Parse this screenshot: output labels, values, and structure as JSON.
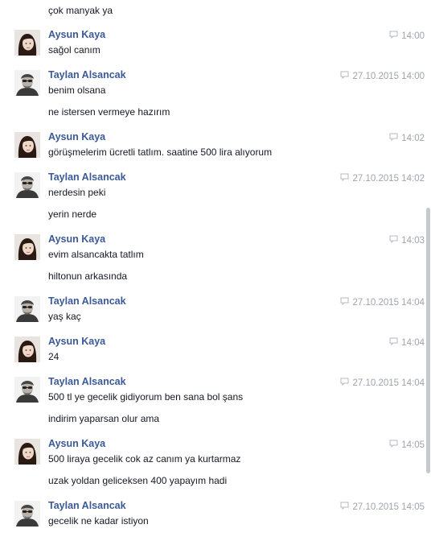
{
  "conversation": {
    "top_continuation": "çok manyak ya",
    "groups": [
      {
        "sender": "Aysun Kaya",
        "avatar": "woman-avatar",
        "time": "14:00",
        "lines": [
          "sağol canım"
        ]
      },
      {
        "sender": "Taylan Alsancak",
        "avatar": "man-avatar",
        "time": "27.10.2015 14:00",
        "lines": [
          "benim olsana",
          "ne istersen vermeye hazırım"
        ]
      },
      {
        "sender": "Aysun Kaya",
        "avatar": "woman-avatar",
        "time": "14:02",
        "lines": [
          "görüşmelerim ücretli tatlım. saatine 500 lira alıyorum"
        ]
      },
      {
        "sender": "Taylan Alsancak",
        "avatar": "man-avatar",
        "time": "27.10.2015 14:02",
        "lines": [
          "nerdesin peki",
          "yerin nerde"
        ]
      },
      {
        "sender": "Aysun Kaya",
        "avatar": "woman-avatar",
        "time": "14:03",
        "lines": [
          "evim alsancakta tatlım",
          "hiltonun arkasında"
        ]
      },
      {
        "sender": "Taylan Alsancak",
        "avatar": "man-avatar",
        "time": "27.10.2015 14:04",
        "lines": [
          "yaş kaç"
        ]
      },
      {
        "sender": "Aysun Kaya",
        "avatar": "woman-avatar",
        "time": "14:04",
        "lines": [
          "24"
        ]
      },
      {
        "sender": "Taylan Alsancak",
        "avatar": "man-avatar",
        "time": "27.10.2015 14:04",
        "lines": [
          "500 tl ye gecelik gidiyorum ben sana bol şans",
          "indirim yaparsan olur ama"
        ]
      },
      {
        "sender": "Aysun Kaya",
        "avatar": "woman-avatar",
        "time": "14:05",
        "lines": [
          "500 liraya gecelik cok az canım ya kurtarmaz",
          "uzak yoldan geliceksen 400 yapayım hadi"
        ]
      },
      {
        "sender": "Taylan Alsancak",
        "avatar": "man-avatar",
        "time": "27.10.2015 14:05",
        "lines": [
          "gecelik ne kadar istiyon"
        ]
      }
    ]
  },
  "colors": {
    "sender_name": "#3b5998",
    "message_text": "#141823",
    "timestamp": "#a0a4ab",
    "scrollbar_thumb": "#c6c9cf"
  },
  "icons": {
    "timestamp": "chat-bubble-icon"
  }
}
